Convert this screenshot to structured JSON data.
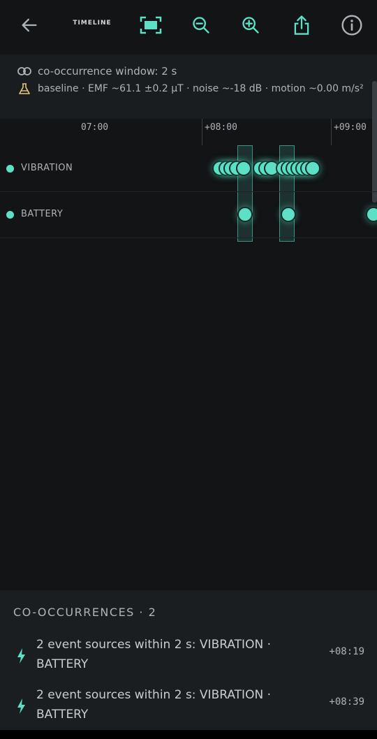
{
  "header": {
    "title": "TIMELINE",
    "icons": [
      "back-arrow-icon",
      "fit-screen-icon",
      "zoom-out-icon",
      "zoom-in-icon",
      "share-icon",
      "info-icon"
    ],
    "accent": "#5de0c6"
  },
  "info": {
    "window_text": "co-occurrence window: 2 s",
    "baseline_text": "baseline · EMF ~61.1 ±0.2 µT · noise ~-18 dB · motion ~0.00 m/s²",
    "baseline_icon_color": "#e5c77a"
  },
  "timeline": {
    "axis_labels": [
      "07:00",
      "+08:00",
      "+09:00"
    ],
    "lanes": [
      {
        "label": "VIBRATION"
      },
      {
        "label": "BATTERY"
      }
    ]
  },
  "co_occurrences": {
    "title": "CO-OCCURRENCES · 2",
    "items": [
      {
        "text": "2 event sources within 2 s: VIBRATION · BATTERY",
        "time": "+08:19"
      },
      {
        "text": "2 event sources within 2 s: VIBRATION · BATTERY",
        "time": "+08:39"
      }
    ]
  }
}
